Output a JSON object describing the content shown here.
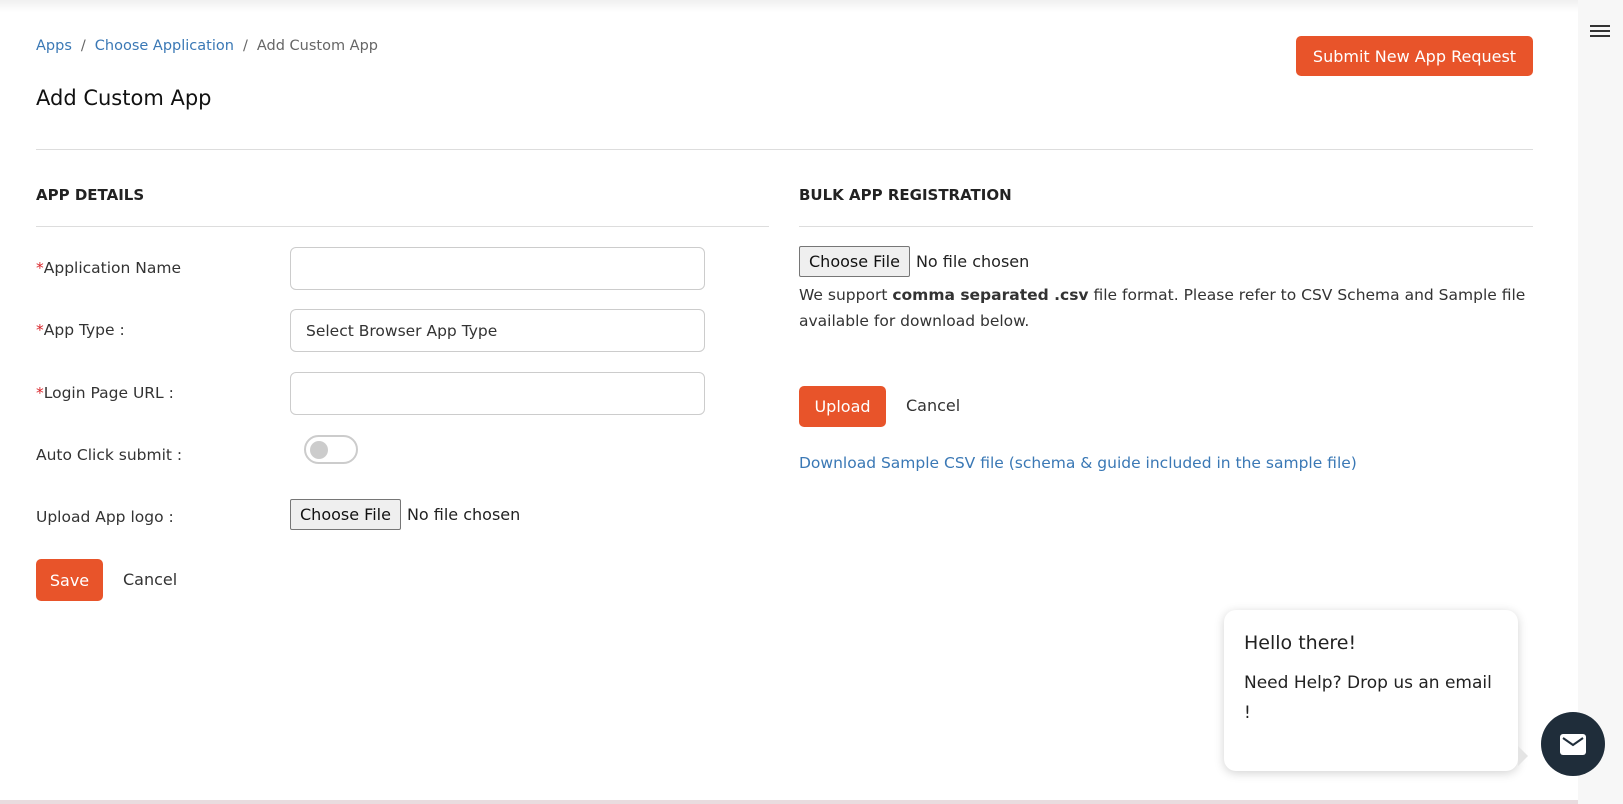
{
  "breadcrumb": {
    "items": [
      "Apps",
      "Choose Application",
      "Add Custom App"
    ],
    "sep": "/"
  },
  "page_title": "Add Custom App",
  "submit_button": "Submit New App Request",
  "app_details": {
    "heading": "APP DETAILS",
    "required_mark": "*",
    "application_name_label": "Application Name",
    "application_name_value": "",
    "app_type_label": "App Type :",
    "app_type_value": "Select Browser App Type",
    "login_url_label": "Login Page URL :",
    "login_url_value": "",
    "auto_click_label": "Auto Click submit :",
    "auto_click_on": false,
    "logo_label": "Upload App logo :",
    "choose_file": "Choose File",
    "no_file": "No file chosen",
    "save": "Save",
    "cancel": "Cancel"
  },
  "bulk": {
    "heading": "BULK APP REGISTRATION",
    "choose_file": "Choose File",
    "no_file": "No file chosen",
    "desc_pre": "We support ",
    "desc_bold": "comma separated .csv",
    "desc_post": " file format. Please refer to CSV Schema and Sample file available for download below.",
    "upload": "Upload",
    "cancel": "Cancel",
    "download_link": "Download Sample CSV file (schema & guide included in the sample file)"
  },
  "chat": {
    "title": "Hello there!",
    "text": "Need Help? Drop us an email !"
  },
  "colors": {
    "accent": "#e8542a",
    "link": "#3a78b5",
    "chat": "#1f2d3a"
  }
}
